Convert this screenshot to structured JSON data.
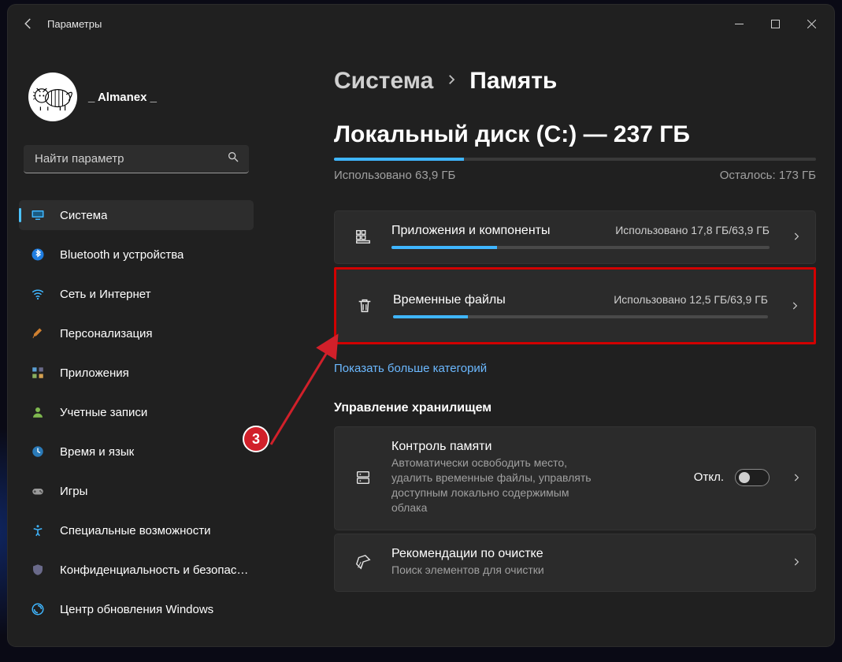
{
  "title": "Параметры",
  "user": {
    "name": "_ Almanex _"
  },
  "search": {
    "placeholder": "Найти параметр"
  },
  "nav": {
    "system": "Система",
    "bluetooth": "Bluetooth и устройства",
    "network": "Сеть и Интернет",
    "personalization": "Персонализация",
    "apps": "Приложения",
    "accounts": "Учетные записи",
    "time": "Время и язык",
    "games": "Игры",
    "accessibility": "Специальные возможности",
    "privacy": "Конфиденциальность и безопасность",
    "update": "Центр обновления Windows"
  },
  "breadcrumb": {
    "parent": "Система",
    "current": "Память"
  },
  "disk": {
    "title": "Локальный диск (C:) — 237 ГБ",
    "used_pct": 27,
    "used_label": "Использовано 63,9 ГБ",
    "free_label": "Осталось: 173 ГБ"
  },
  "cards": {
    "apps": {
      "title": "Приложения и компоненты",
      "usage": "Использовано 17,8 ГБ/63,9 ГБ",
      "pct": 28
    },
    "temp": {
      "title": "Временные файлы",
      "usage": "Использовано 12,5 ГБ/63,9 ГБ",
      "pct": 20
    }
  },
  "more_categories": "Показать больше категорий",
  "storage_mgmt": {
    "heading": "Управление хранилищем",
    "sense": {
      "title": "Контроль памяти",
      "desc": "Автоматически освободить место, удалить временные файлы, управлять доступным локально содержимым облака",
      "toggle_label": "Откл."
    },
    "recommend": {
      "title": "Рекомендации по очистке",
      "desc": "Поиск элементов для очистки"
    }
  },
  "annotation": {
    "number": "3"
  }
}
